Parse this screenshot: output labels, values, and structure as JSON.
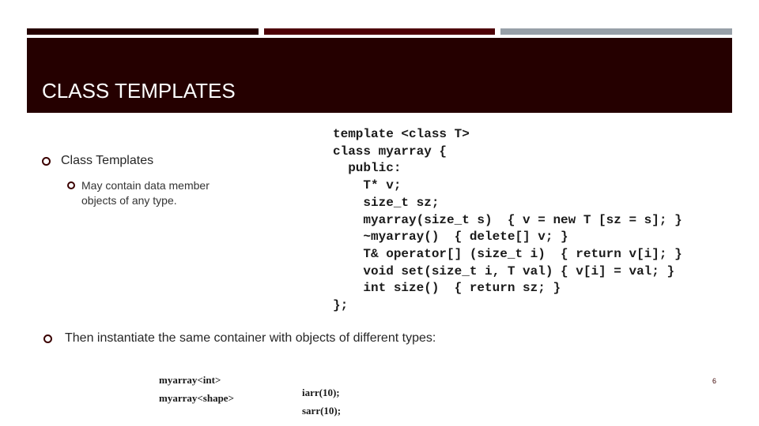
{
  "slide": {
    "title": "CLASS TEMPLATES",
    "bullets": {
      "level1_a": "Class Templates",
      "level2_a": "May contain data member objects of any type.",
      "level1_b": "Then instantiate the same container with objects of different types:"
    },
    "code_lines": [
      "template <class T>",
      "class myarray {",
      "  public:",
      "    T* v;",
      "    size_t sz;",
      "    myarray(size_t s)  { v = new T [sz = s]; }",
      "    ~myarray()  { delete[] v; }",
      "    T& operator[] (size_t i)  { return v[i]; }",
      "    void set(size_t i, T val) { v[i] = val; }",
      "    int size()  { return sz; }",
      "};"
    ],
    "instantiations": [
      {
        "type": "myarray<int>",
        "decl": "iarr(10);"
      },
      {
        "type": "myarray<shape>",
        "decl": "sarr(10);"
      }
    ],
    "page_number": "6"
  },
  "colors": {
    "header_bg": "#250000",
    "accent_dark": "#250000",
    "accent_red": "#4d0006",
    "accent_gray": "#97a0a8",
    "bullet": "#3a0000"
  }
}
